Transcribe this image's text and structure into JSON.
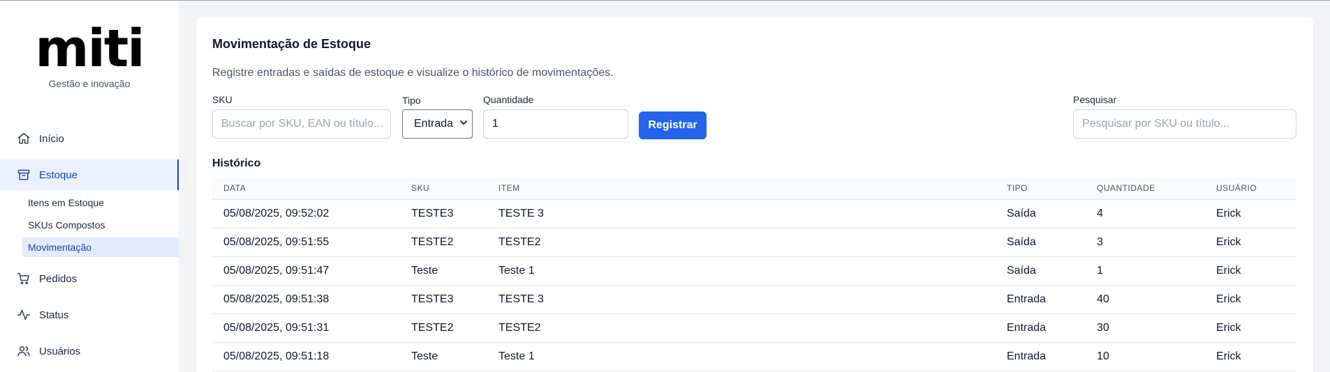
{
  "sidebar": {
    "logo": "miti",
    "tagline": "Gestão e inovação",
    "nav": {
      "inicio": "Início",
      "estoque": "Estoque",
      "pedidos": "Pedidos",
      "status": "Status",
      "usuarios": "Usuários"
    },
    "estoque_sub": {
      "itens": "Itens em Estoque",
      "skus": "SKUs Compostos",
      "movimentacao": "Movimentação"
    }
  },
  "main": {
    "title": "Movimentação de Estoque",
    "description": "Registre entradas e saídas de estoque e visualize o histórico de movimentações.",
    "form": {
      "sku_label": "SKU",
      "sku_placeholder": "Buscar por SKU, EAN ou título...",
      "tipo_label": "Tipo",
      "tipo_value": "Entrada",
      "quantidade_label": "Quantidade",
      "quantidade_value": "1",
      "register_button": "Registrar",
      "search_label": "Pesquisar",
      "search_placeholder": "Pesquisar por SKU ou título..."
    },
    "history_title": "Histórico",
    "table": {
      "headers": {
        "data": "DATA",
        "sku": "SKU",
        "item": "ITEM",
        "tipo": "TIPO",
        "quantidade": "QUANTIDADE",
        "usuario": "USUÁRIO"
      },
      "rows": [
        {
          "data": "05/08/2025, 09:52:02",
          "sku": "TESTE3",
          "item": "TESTE 3",
          "tipo": "Saída",
          "quantidade": "4",
          "usuario": "Erick"
        },
        {
          "data": "05/08/2025, 09:51:55",
          "sku": "TESTE2",
          "item": "TESTE2",
          "tipo": "Saída",
          "quantidade": "3",
          "usuario": "Erick"
        },
        {
          "data": "05/08/2025, 09:51:47",
          "sku": "Teste",
          "item": "Teste 1",
          "tipo": "Saída",
          "quantidade": "1",
          "usuario": "Erick"
        },
        {
          "data": "05/08/2025, 09:51:38",
          "sku": "TESTE3",
          "item": "TESTE 3",
          "tipo": "Entrada",
          "quantidade": "40",
          "usuario": "Erick"
        },
        {
          "data": "05/08/2025, 09:51:31",
          "sku": "TESTE2",
          "item": "TESTE2",
          "tipo": "Entrada",
          "quantidade": "30",
          "usuario": "Erick"
        },
        {
          "data": "05/08/2025, 09:51:18",
          "sku": "Teste",
          "item": "Teste 1",
          "tipo": "Entrada",
          "quantidade": "10",
          "usuario": "Erick"
        }
      ]
    }
  },
  "icons": {
    "inicio": "home-icon",
    "estoque": "archive-box-icon",
    "pedidos": "shopping-cart-icon",
    "status": "activity-pulse-icon",
    "usuarios": "users-icon",
    "select_caret": "chevron-down-icon"
  },
  "colors": {
    "accent": "#2563eb",
    "active_nav_bg": "#eaf1fc",
    "active_nav_text": "#1e40af"
  }
}
